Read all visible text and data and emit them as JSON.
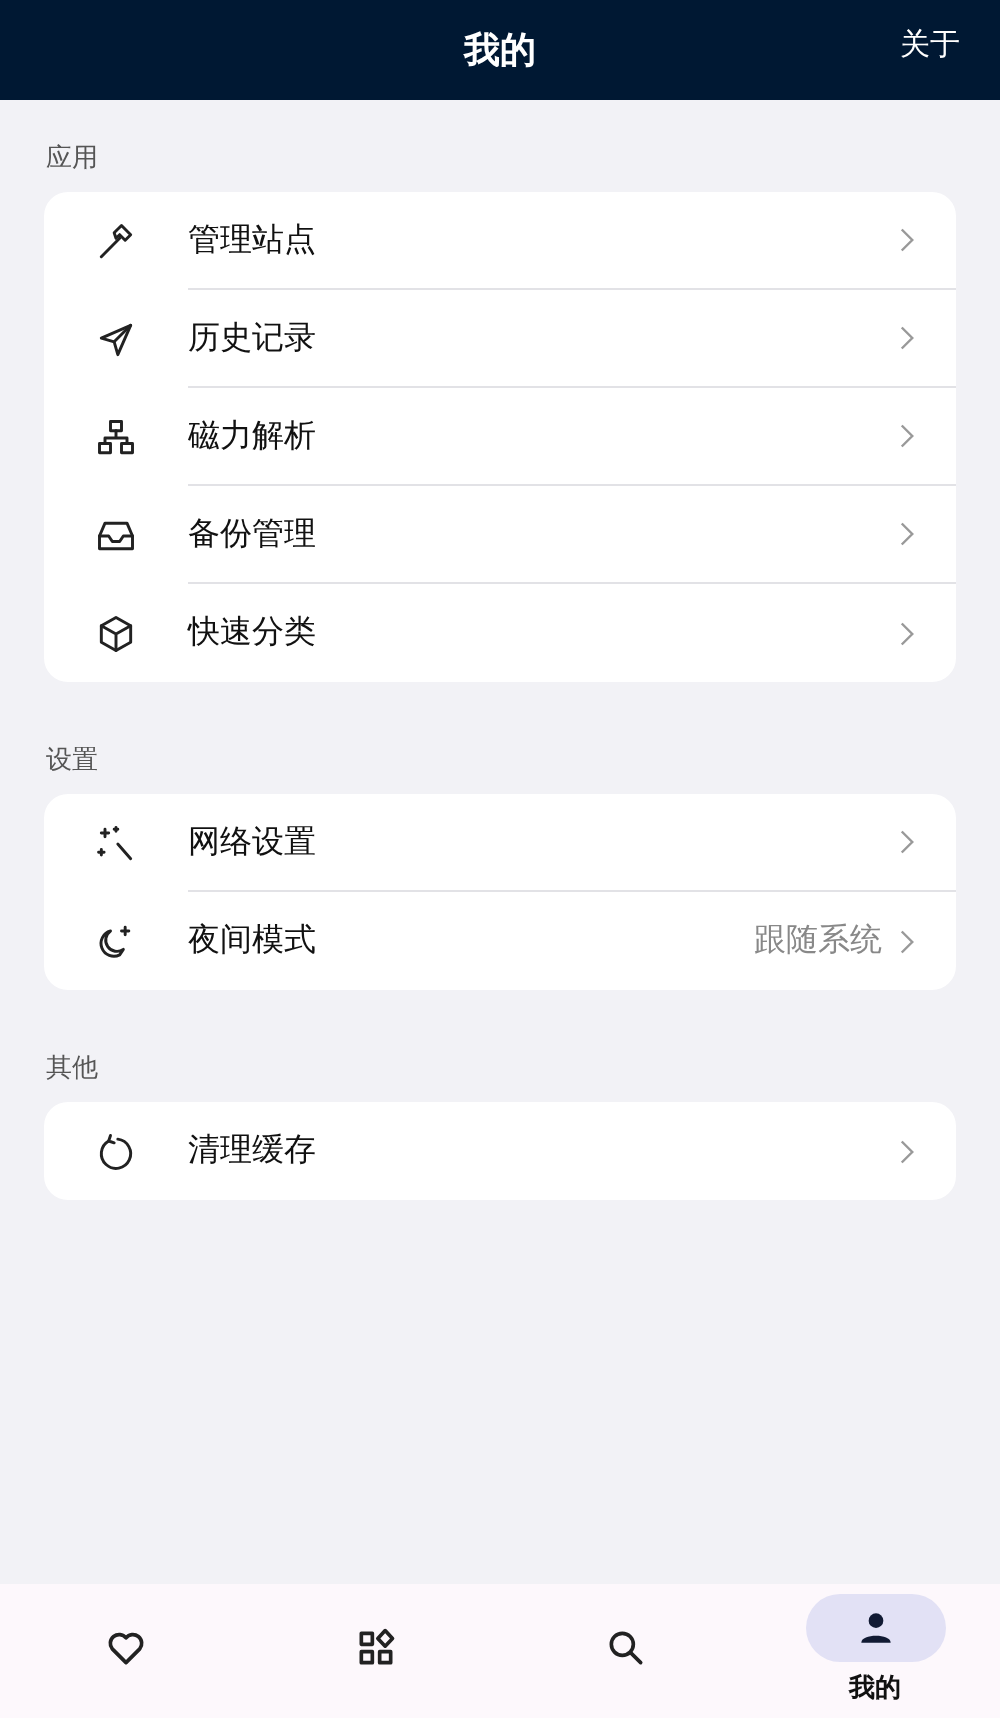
{
  "header": {
    "title": "我的",
    "action": "关于"
  },
  "sections": [
    {
      "title": "应用",
      "items": [
        {
          "label": "管理站点"
        },
        {
          "label": "历史记录"
        },
        {
          "label": "磁力解析"
        },
        {
          "label": "备份管理"
        },
        {
          "label": "快速分类"
        }
      ]
    },
    {
      "title": "设置",
      "items": [
        {
          "label": "网络设置"
        },
        {
          "label": "夜间模式",
          "value": "跟随系统"
        }
      ]
    },
    {
      "title": "其他",
      "items": [
        {
          "label": "清理缓存"
        }
      ]
    }
  ],
  "nav": [
    {
      "selected": false
    },
    {
      "selected": false
    },
    {
      "selected": false
    },
    {
      "selected": true,
      "label": "我的"
    }
  ]
}
